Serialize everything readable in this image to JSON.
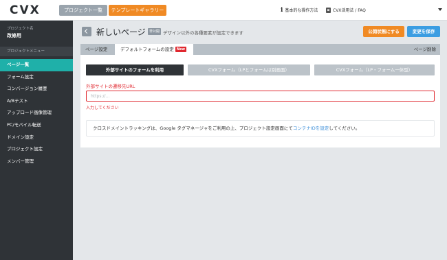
{
  "topbar": {
    "logo": "CVX",
    "projects_button": "プロジェクト一覧",
    "templates_button": "テンプレートギャラリー",
    "guide_link": "基本的な操作方法",
    "faq_link": "CVX活用法 / FAQ"
  },
  "sidebar": {
    "project_caption": "プロジェクト名",
    "project_name": "改修用",
    "menu_caption": "プロジェクトメニュー",
    "items": [
      {
        "label": "ページ一覧"
      },
      {
        "label": "フォーム設定"
      },
      {
        "label": "コンバージョン履歴"
      },
      {
        "label": "A/Bテスト"
      },
      {
        "label": "アップロード画像管理"
      },
      {
        "label": "PC/モバイル転送"
      },
      {
        "label": "ドメイン設定"
      },
      {
        "label": "プロジェクト設定"
      },
      {
        "label": "メンバー管理"
      }
    ]
  },
  "header": {
    "title": "新しいページ",
    "status_badge": "非公開",
    "subtitle": "デザイン以外の各種要素が設定できます",
    "publish_button": "公開状態にする",
    "save_button": "変更を保存"
  },
  "tabs": {
    "page_settings": "ページ設定",
    "default_form": "デフォルトフォームの設定",
    "new_badge": "New",
    "delete_page": "ページ削除"
  },
  "form_options": {
    "external": "外部サイトのフォームを利用",
    "cvx_separate": "CVXフォーム（LPとフォームは別画面）",
    "cvx_integrated": "CVXフォーム（LP・フォーム一体型）"
  },
  "url_field": {
    "label": "外部サイトの遷移先URL",
    "placeholder": "https://...",
    "value": "",
    "error": "入力してください"
  },
  "info": {
    "text": "クロスドメイントラッキングは、Google タグマネージャをご利用の上、プロジェクト設定画面にて",
    "link": "コンテナIDを設定",
    "suffix": "してください。"
  },
  "colors": {
    "accent_orange": "#f08a24",
    "accent_blue": "#3b9de2",
    "active_teal": "#1fb0a9",
    "error_red": "#e0282f",
    "sidebar_dark": "#2f3337"
  },
  "icons": {
    "guide": "info-icon",
    "faq": "book-icon",
    "account_menu": "chevron-down-icon",
    "back": "chevron-left-icon"
  }
}
